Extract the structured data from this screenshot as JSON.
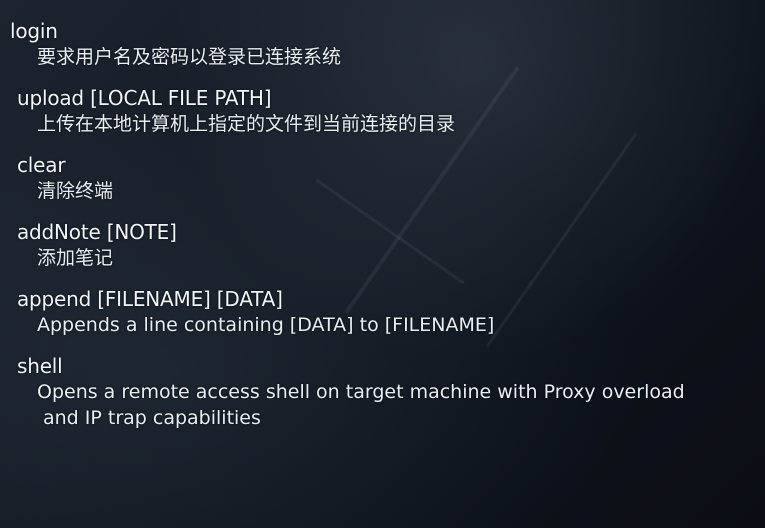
{
  "commands": [
    {
      "name": "login",
      "description": "要求用户名及密码以登录已连接系统"
    },
    {
      "name": "upload [LOCAL FILE PATH]",
      "description": "上传在本地计算机上指定的文件到当前连接的目录"
    },
    {
      "name": "clear",
      "description": "清除终端"
    },
    {
      "name": "addNote [NOTE]",
      "description": "添加笔记"
    },
    {
      "name": "append [FILENAME] [DATA]",
      "description": "Appends a line containing [DATA] to [FILENAME]"
    },
    {
      "name": "shell",
      "description": "Opens a remote access shell on target machine with Proxy overload",
      "description_cont": "and IP trap capabilities"
    }
  ]
}
